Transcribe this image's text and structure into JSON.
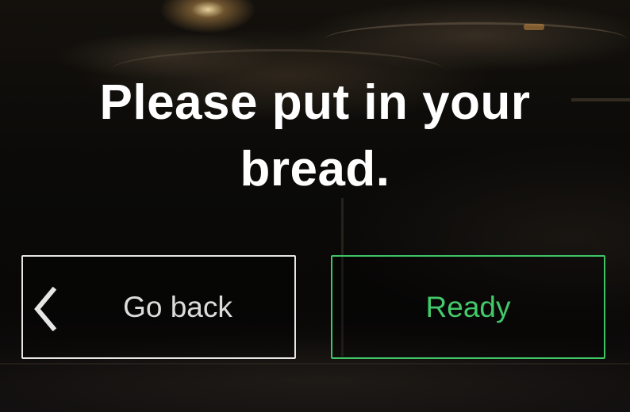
{
  "prompt": {
    "title": "Please put in your bread."
  },
  "actions": {
    "back": {
      "label": "Go back",
      "icon": "chevron-left-icon"
    },
    "ready": {
      "label": "Ready"
    }
  },
  "colors": {
    "title_text": "#ffffff",
    "back_border": "#e6e6e6",
    "back_text": "#dcdcdc",
    "ready_accent": "#43c96a"
  }
}
